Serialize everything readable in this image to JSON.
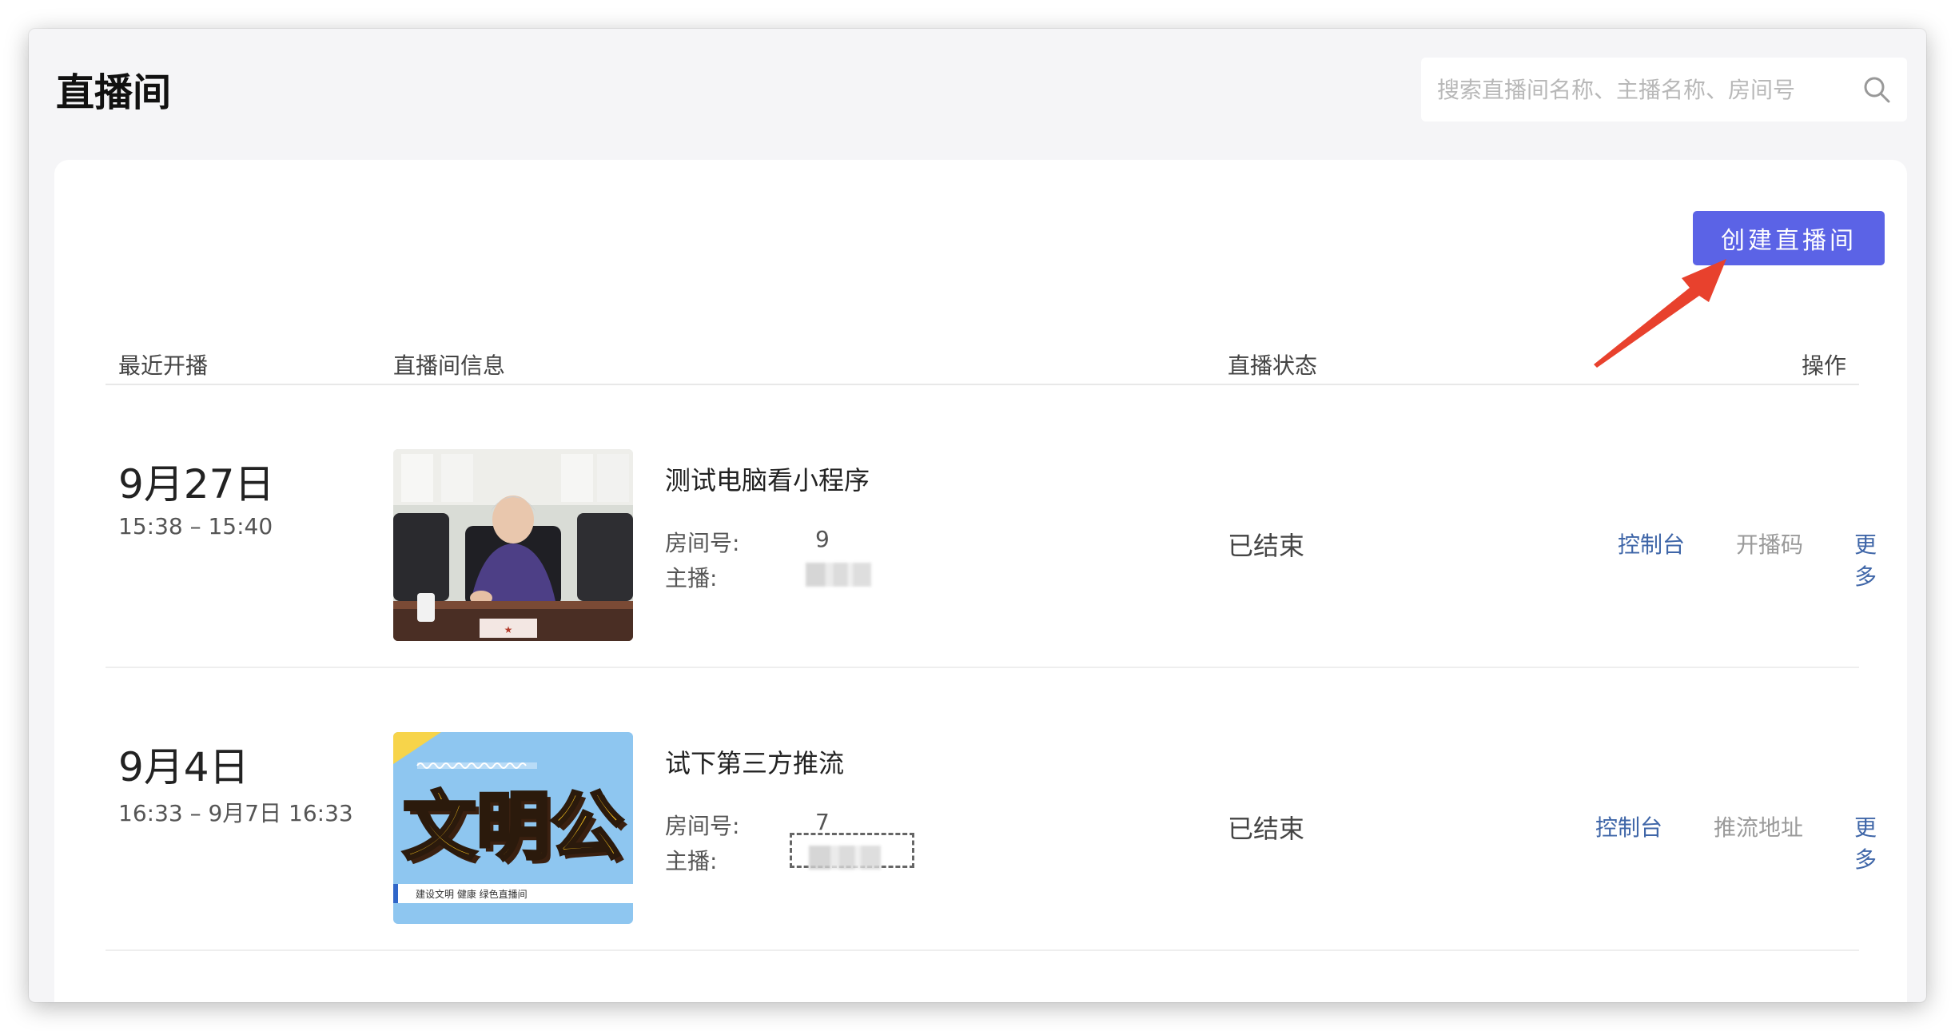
{
  "page": {
    "title": "直播间"
  },
  "search": {
    "placeholder": "搜索直播间名称、主播名称、房间号",
    "value": ""
  },
  "toolbar": {
    "create_label": "创建直播间"
  },
  "table": {
    "columns": {
      "recent": "最近开播",
      "info": "直播间信息",
      "status": "直播状态",
      "actions": "操作"
    },
    "room_no_label": "房间号:",
    "host_label": "主播:",
    "rows": [
      {
        "date": "9月27日",
        "time": "15:38 – 15:40",
        "name": "测试电脑看小程序",
        "room_no": "9",
        "status": "已结束",
        "actions": [
          "控制台",
          "开播码",
          "更多"
        ],
        "thumb": {
          "nameplate": "★"
        }
      },
      {
        "date": "9月4日",
        "time": "16:33 – 9月7日 16:33",
        "name": "试下第三方推流",
        "room_no": "7",
        "status": "已结束",
        "actions": [
          "控制台",
          "推流地址",
          "更多"
        ],
        "thumb": {
          "headline": "文明公",
          "subline": "建设文明 健康 绿色直播间"
        }
      }
    ]
  },
  "colors": {
    "accent": "#5b63e6",
    "link": "#3f66a8",
    "muted_link": "#9a9a9a",
    "annotation_arrow": "#e8412d"
  }
}
